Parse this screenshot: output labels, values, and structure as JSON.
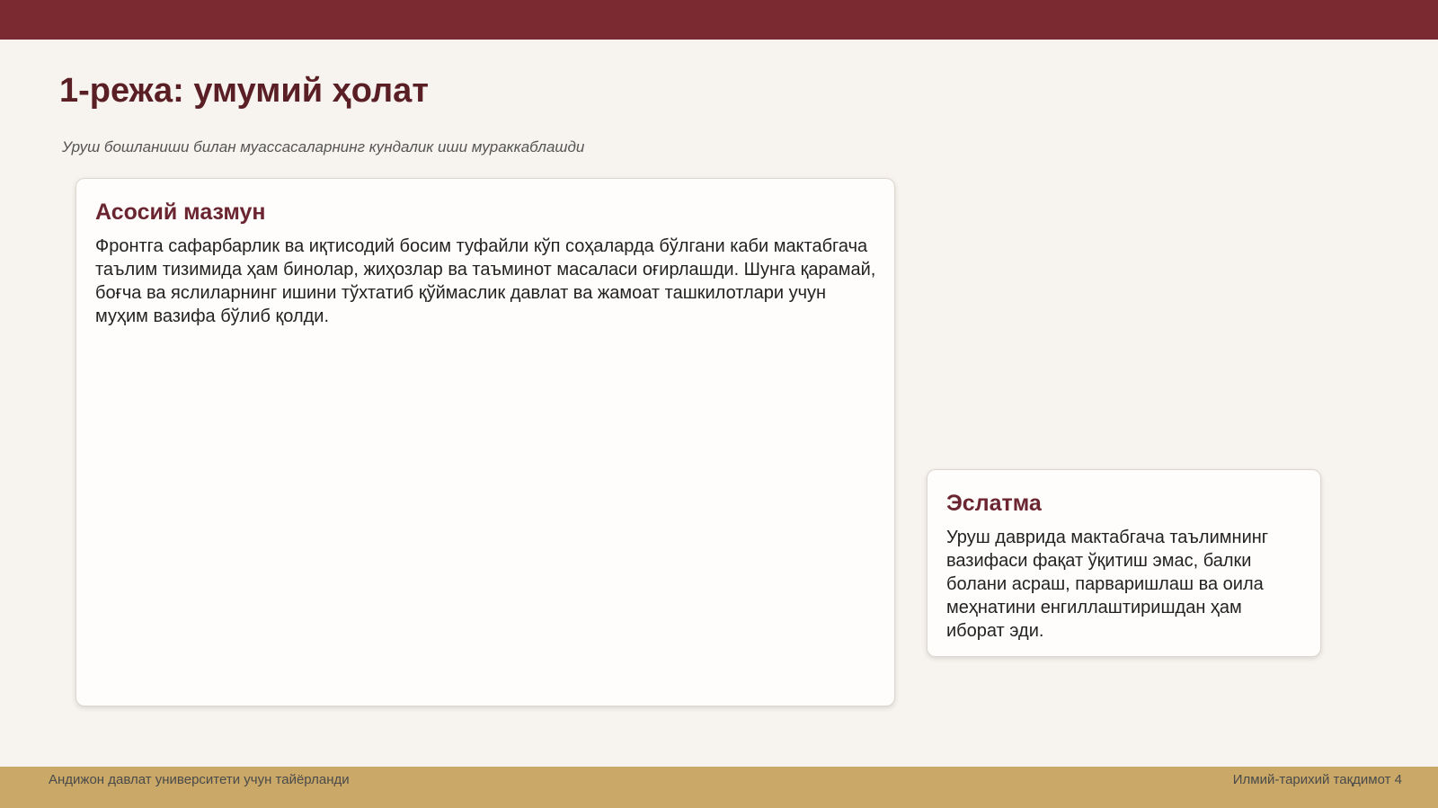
{
  "slide": {
    "title": "1-режа: умумий ҳолат",
    "subtitle": "Уруш бошланиши билан муассасаларнинг кундалик иши мураккаблашди"
  },
  "main_card": {
    "heading": "Асосий мазмун",
    "body": "Фронтга сафарбарлик ва иқтисодий босим туфайли кўп соҳаларда бўлгани каби мактабгача таълим тизимида ҳам бинолар, жиҳозлар ва таъминот масаласи оғирлашди. Шунга қарамай, боғча ва яслиларнинг ишини тўхтатиб қўймаслик давлат ва жамоат ташкилотлари учун муҳим вазифа бўлиб қолди."
  },
  "note_card": {
    "heading": "Эслатма",
    "body": "Уруш даврида мактабгача таълимнинг вазифаси фақат ўқитиш эмас, балки болани асраш, парваришлаш ва оила меҳнатини енгиллаштиришдан ҳам иборат эди."
  },
  "footer": {
    "left": "Андижон давлат университети учун тайёрланди",
    "right": "Илмий-тарихий тақдимот 4"
  },
  "colors": {
    "top_bar": "#7a2a30",
    "footer_bar": "#c9a868",
    "title": "#5a1f25",
    "card_heading": "#6b2530",
    "background": "#f7f3ee"
  }
}
